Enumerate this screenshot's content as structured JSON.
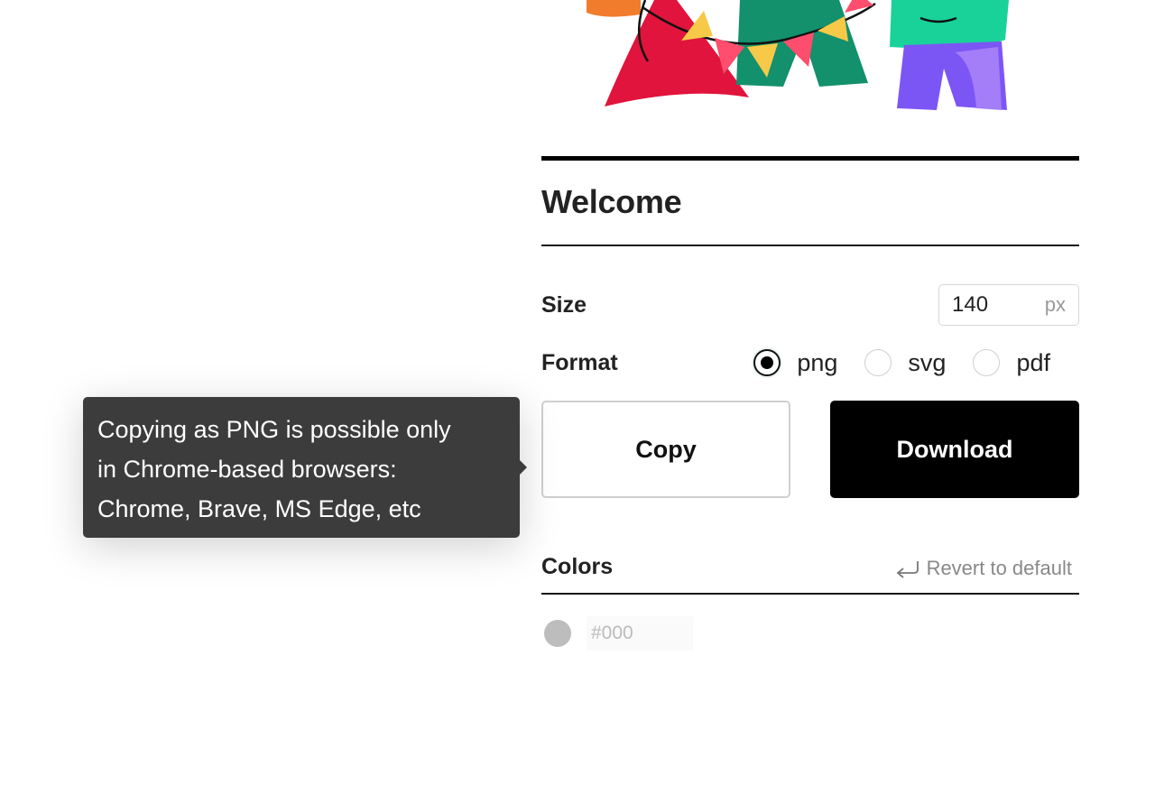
{
  "section": {
    "title": "Welcome"
  },
  "size": {
    "label": "Size",
    "value": "140",
    "unit": "px"
  },
  "format": {
    "label": "Format",
    "options": [
      "png",
      "svg",
      "pdf"
    ],
    "selected": "png"
  },
  "actions": {
    "copy_label": "Copy",
    "download_label": "Download"
  },
  "tooltip": {
    "lines": [
      "Copying as PNG is possible only",
      "in Chrome-based browsers:",
      "Chrome, Brave, MS Edge, etc"
    ]
  },
  "colors": {
    "label": "Colors",
    "revert_label": "Revert to default",
    "items": [
      {
        "value": "#000",
        "swatch": "#bdbdbd"
      }
    ]
  },
  "icons": {
    "revert": "return-arrow-icon",
    "illustration": "party-people-illustration"
  }
}
